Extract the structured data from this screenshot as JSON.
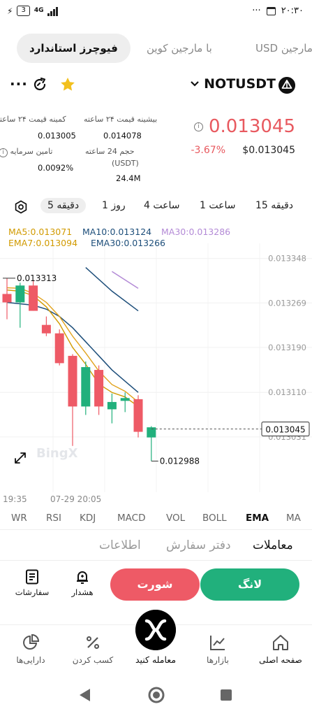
{
  "status_bar": {
    "battery": "3",
    "network": "4G",
    "time": "۲۰:۳۰",
    "more": "···"
  },
  "top_tabs": [
    {
      "label": "USD مارجین"
    },
    {
      "label": "با مارجین کوین"
    },
    {
      "label": "فیوچرز استاندارد",
      "active": true
    }
  ],
  "symbol": {
    "name": "NOTUSDT",
    "more": "···"
  },
  "stats": {
    "last_price": "0.013045",
    "change_pct": "-3.67%",
    "usd_price": "$0.013045",
    "high_label": "بیشینه قیمت ۲۴ ساعته",
    "high_value": "0.014078",
    "low_label": "کمینه قیمت ۲۴ ساعته",
    "low_value": "0.013005",
    "volume_label": "حجم 24 ساعته",
    "volume_unit": "(USDT)",
    "volume_value": "24.4M",
    "funding_label": "تامین سرمایه",
    "funding_value": "0.0092%"
  },
  "intervals": [
    "دقیقه 15",
    "ساعت 1",
    "ساعت 4",
    "روز 1",
    "دقیقه 5"
  ],
  "active_interval": "دقیقه 5",
  "chart_data": {
    "type": "candlestick",
    "ma_labels": {
      "ma5": "MA5:0.013071",
      "ma10": "MA10:0.013124",
      "ma30": "MA30:0.013286",
      "ema7": "EMA7:0.013094",
      "ema30": "EMA30:0.013266"
    },
    "y_ticks": [
      "0.013348",
      "0.013269",
      "0.013190",
      "0.013110",
      "0.013031"
    ],
    "ylim": [
      0.01295,
      0.01337
    ],
    "x_ticks": [
      "19:35",
      "07-29 20:05"
    ],
    "current_price_tag": "0.013045",
    "high_marker": "0.013313",
    "low_marker": "0.012988",
    "watermark": "BingX",
    "candles": [
      {
        "o": 0.013285,
        "h": 0.013313,
        "l": 0.01324,
        "c": 0.01327
      },
      {
        "o": 0.01327,
        "h": 0.013305,
        "l": 0.013225,
        "c": 0.0133
      },
      {
        "o": 0.0133,
        "h": 0.01331,
        "l": 0.013255,
        "c": 0.013255
      },
      {
        "o": 0.01323,
        "h": 0.013245,
        "l": 0.01321,
        "c": 0.013215
      },
      {
        "o": 0.013215,
        "h": 0.013222,
        "l": 0.013158,
        "c": 0.013162
      },
      {
        "o": 0.013175,
        "h": 0.013178,
        "l": 0.013015,
        "c": 0.013085
      },
      {
        "o": 0.013085,
        "h": 0.013165,
        "l": 0.01307,
        "c": 0.013155
      },
      {
        "o": 0.01315,
        "h": 0.013158,
        "l": 0.01307,
        "c": 0.013085
      },
      {
        "o": 0.01308,
        "h": 0.013108,
        "l": 0.013055,
        "c": 0.013093
      },
      {
        "o": 0.013095,
        "h": 0.01311,
        "l": 0.013075,
        "c": 0.0131
      },
      {
        "o": 0.013098,
        "h": 0.013105,
        "l": 0.01303,
        "c": 0.01304
      },
      {
        "o": 0.01303,
        "h": 0.01305,
        "l": 0.012988,
        "c": 0.013048
      }
    ],
    "ma5": [
      [
        0,
        0.013292
      ],
      [
        1,
        0.01329
      ],
      [
        2,
        0.013282
      ],
      [
        3,
        0.013262
      ],
      [
        4,
        0.013232
      ],
      [
        5,
        0.01319
      ],
      [
        6,
        0.01316
      ],
      [
        7,
        0.013125
      ],
      [
        8,
        0.01311
      ],
      [
        9,
        0.013102
      ],
      [
        10,
        0.013085
      ]
    ],
    "ema7": [
      [
        0,
        0.013296
      ],
      [
        1,
        0.013295
      ],
      [
        2,
        0.013286
      ],
      [
        3,
        0.01327
      ],
      [
        4,
        0.013245
      ],
      [
        5,
        0.01321
      ],
      [
        6,
        0.01318
      ],
      [
        7,
        0.013148
      ],
      [
        8,
        0.013124
      ],
      [
        9,
        0.013112
      ],
      [
        10,
        0.013093
      ]
    ],
    "ma10": [
      [
        6,
        0.013332
      ],
      [
        8,
        0.01329
      ],
      [
        10,
        0.013255
      ]
    ],
    "ma30": [
      [
        8,
        0.013325
      ],
      [
        10,
        0.013295
      ]
    ],
    "ema30_full": [
      [
        0,
        0.01327
      ],
      [
        2,
        0.013265
      ],
      [
        3,
        0.013258
      ],
      [
        4,
        0.013245
      ],
      [
        5,
        0.013225
      ],
      [
        6,
        0.0132
      ],
      [
        7,
        0.013175
      ],
      [
        8,
        0.01315
      ],
      [
        9,
        0.01313
      ],
      [
        10,
        0.01311
      ]
    ]
  },
  "indicator_tabs": [
    "MA",
    "EMA",
    "BOLL",
    "VOL",
    "MACD",
    "KDJ",
    "RSI",
    "WR"
  ],
  "active_indicator": "EMA",
  "trade_tabs": [
    "معاملات",
    "دفتر سفارش",
    "اطلاعات"
  ],
  "active_trade_tab": "معاملات",
  "actions": {
    "long": "لانگ",
    "short": "شورت",
    "alert": "هشدار",
    "orders": "سفارشات"
  },
  "bottom_nav": {
    "home": "صفحه اصلی",
    "markets": "بازارها",
    "trade": "معامله کنید",
    "earn": "کسب کردن",
    "assets": "دارایی‌ها"
  },
  "colors": {
    "up": "#21b07c",
    "down": "#ee5a66",
    "ma5": "#d19a00",
    "ma10": "#1d4e7a",
    "ma30": "#b38ad6"
  }
}
